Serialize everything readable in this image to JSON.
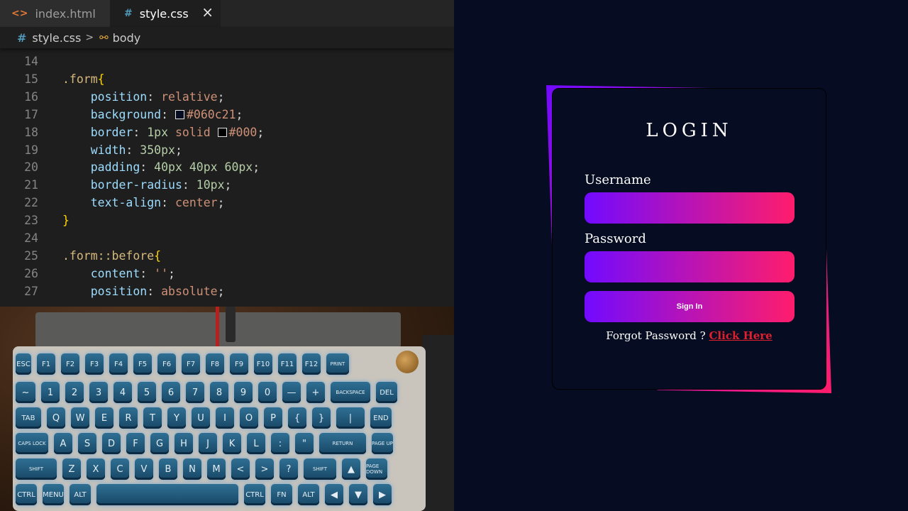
{
  "editor": {
    "tabs": [
      {
        "icon": "<>",
        "label": "index.html"
      },
      {
        "icon": "#",
        "label": "style.css",
        "close": "×"
      }
    ],
    "breadcrumb": {
      "file_icon": "#",
      "file": "style.css",
      "separator": ">",
      "symbol_icon": "⚯",
      "symbol": "body"
    },
    "lines": [
      {
        "n": "14"
      },
      {
        "n": "15",
        "sel": ".form",
        "brace": "{"
      },
      {
        "n": "16",
        "prop": "position",
        "val": "relative"
      },
      {
        "n": "17",
        "prop": "background",
        "val": "#060c21",
        "swatch": "#060c21"
      },
      {
        "n": "18",
        "prop": "border",
        "num": "1px",
        "val": "solid",
        "val2": "#000",
        "swatch": "#000000"
      },
      {
        "n": "19",
        "prop": "width",
        "num": "350px"
      },
      {
        "n": "20",
        "prop": "padding",
        "num": "40px 40px 60px"
      },
      {
        "n": "21",
        "prop": "border-radius",
        "num": "10px"
      },
      {
        "n": "22",
        "prop": "text-align",
        "val": "center"
      },
      {
        "n": "23",
        "brace": "}"
      },
      {
        "n": "24"
      },
      {
        "n": "25",
        "sel": ".form::before",
        "brace": "{"
      },
      {
        "n": "26",
        "prop": "content",
        "val": "''"
      },
      {
        "n": "27",
        "prop": "position",
        "val": "absolute"
      }
    ]
  },
  "keyboard": {
    "rows": [
      [
        "ESC",
        "F1",
        "F2",
        "F3",
        "F4",
        "F5",
        "F6",
        "F7",
        "F8",
        "F9",
        "F10",
        "F11",
        "F12",
        "PRINT"
      ],
      [
        "~",
        "1",
        "2",
        "3",
        "4",
        "5",
        "6",
        "7",
        "8",
        "9",
        "0",
        "—",
        "+",
        "BACKSPACE",
        "DEL"
      ],
      [
        "TAB",
        "Q",
        "W",
        "E",
        "R",
        "T",
        "Y",
        "U",
        "I",
        "O",
        "P",
        "{",
        "}",
        "|",
        "END"
      ],
      [
        "CAPS LOCK",
        "A",
        "S",
        "D",
        "F",
        "G",
        "H",
        "J",
        "K",
        "L",
        ":",
        "\"",
        "RETURN",
        "PAGE UP"
      ],
      [
        "SHIFT",
        "Z",
        "X",
        "C",
        "V",
        "B",
        "N",
        "M",
        "<",
        ">",
        "?",
        "SHIFT",
        "▲",
        "PAGE DOWN"
      ],
      [
        "CTRL",
        "MENU",
        "ALT",
        "",
        "CTRL",
        "FN",
        "ALT",
        "◀",
        "▼",
        "▶"
      ]
    ]
  },
  "login": {
    "title": "LOGIN",
    "username_label": "Username",
    "username_value": "",
    "password_label": "Password",
    "password_value": "",
    "signin_label": "Sign In",
    "forgot_text": "Forgot Password ?",
    "forgot_link": "Click Here"
  },
  "colors": {
    "editor_bg": "#1e1e1e",
    "preview_bg": "#060c21",
    "gradient_start": "#720aff",
    "gradient_end": "#ff1d6c",
    "link": "#e0212d"
  }
}
